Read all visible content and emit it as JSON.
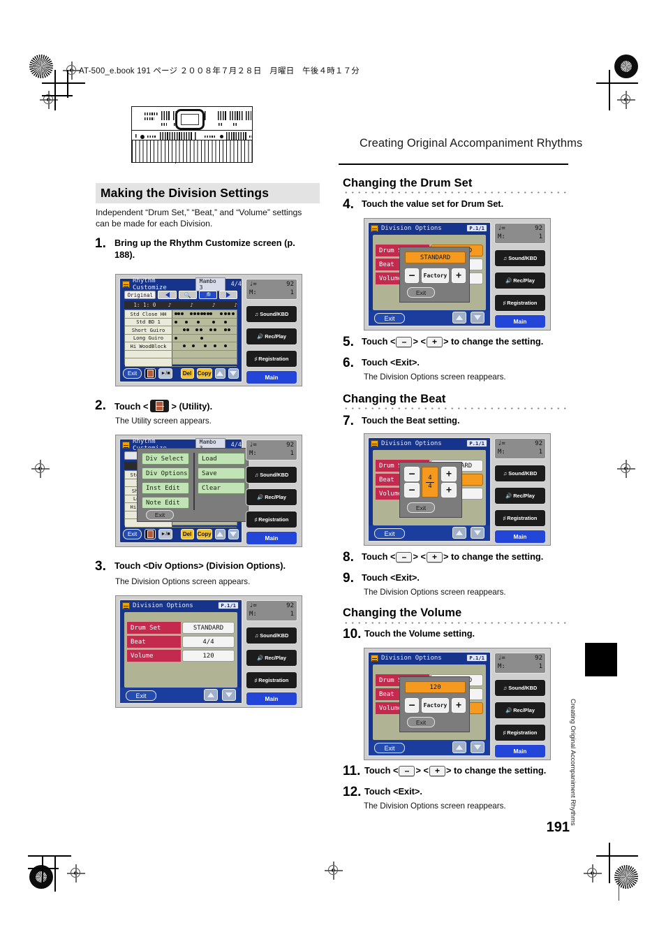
{
  "print_header": "AT-500_e.book 191 ページ ２００８年７月２８日　月曜日　午後４時１７分",
  "running_head": "Creating Original Accompaniment Rhythms",
  "side_tab_label": "Creating Original Accompaniment Rhythms",
  "page_number": "191",
  "left_column": {
    "section_title": "Making the Division Settings",
    "intro": "Independent “Drum Set,” “Beat,” and “Volume” settings can be made for each Division.",
    "steps": [
      {
        "num": "1.",
        "text": "Bring up the Rhythm Customize screen (p. 188).",
        "note": ""
      },
      {
        "num": "2.",
        "text_before": "Touch <",
        "text_after": "> (Utility).",
        "note": "The Utility screen appears."
      },
      {
        "num": "3.",
        "text": "Touch <Div Options> (Division Options).",
        "note": "The Division Options screen appears."
      }
    ]
  },
  "right_column": {
    "sections": [
      {
        "title": "Changing the Drum Set"
      },
      {
        "title": "Changing the Beat"
      },
      {
        "title": "Changing the Volume"
      }
    ],
    "steps": [
      {
        "num": "4.",
        "text": "Touch the value set for Drum Set.",
        "note": ""
      },
      {
        "num": "5.",
        "pre": "Touch <",
        "minus": "–",
        "mid": "> <",
        "plus": "+",
        "post": "> to change the setting.",
        "note": ""
      },
      {
        "num": "6.",
        "text": "Touch <Exit>.",
        "note": "The Division Options screen reappears."
      },
      {
        "num": "7.",
        "text": "Touch the Beat setting.",
        "note": ""
      },
      {
        "num": "8.",
        "pre": "Touch <",
        "minus": "–",
        "mid": "> <",
        "plus": "+",
        "post": "> to change the setting.",
        "note": ""
      },
      {
        "num": "9.",
        "text": "Touch <Exit>.",
        "note": "The Division Options screen reappears."
      },
      {
        "num": "10.",
        "text": "Touch the Volume setting.",
        "note": ""
      },
      {
        "num": "11.",
        "pre": "Touch <",
        "minus": "–",
        "mid": "> <",
        "plus": "+",
        "post": "> to change the setting.",
        "note": ""
      },
      {
        "num": "12.",
        "text": "Touch <Exit>.",
        "note": "The Division Options screen reappears."
      }
    ]
  },
  "lcd_common": {
    "tempo_note": "♩=",
    "tempo_value": "92",
    "measure_label": "M:",
    "measure_value": "1",
    "buttons": [
      {
        "label": "Sound/KBD",
        "icon": "note-icon"
      },
      {
        "label": "Rec/Play",
        "icon": "speaker-icon"
      },
      {
        "label": "Registration",
        "icon": "registration-icon"
      }
    ],
    "main_button": "Main",
    "exit_button": "Exit",
    "page_badge": "P.1/1"
  },
  "screens": {
    "rhythm_customize": {
      "title": "Rhythm Customize",
      "rhythm_name": "Mambo 3",
      "beat": "4/4",
      "original_button": "Original",
      "position": "1: 1:  0",
      "tracks": [
        {
          "name": "Std Close HH",
          "hits": [
            3,
            8,
            13,
            27,
            33,
            38,
            43,
            48,
            53,
            58,
            74,
            80,
            86,
            92
          ]
        },
        {
          "name": "Std BD 1",
          "hits": [
            3,
            20,
            38,
            62,
            80
          ]
        },
        {
          "name": "Short Guiro",
          "hits": [
            16,
            22,
            36,
            42,
            58,
            64,
            80,
            86
          ]
        },
        {
          "name": "Long Guiro",
          "hits": [
            3,
            43
          ]
        },
        {
          "name": "Hi WoodBlock",
          "hits": [
            16,
            30,
            49,
            64,
            80
          ]
        },
        {
          "name": "",
          "hits": []
        },
        {
          "name": "",
          "hits": []
        }
      ],
      "bottom_buttons": [
        "Exit",
        "utility-icon",
        "▶/■",
        "Del",
        "Copy",
        "up-arrow",
        "down-arrow"
      ]
    },
    "utility_overlay": {
      "left_items": [
        "Div Select",
        "Div Options",
        "Inst Edit",
        "Note Edit"
      ],
      "right_items": [
        "Load",
        "Save",
        "Clear"
      ],
      "exit_button": "Exit"
    },
    "division_options": {
      "title": "Division Options",
      "rows": [
        {
          "label": "Drum Set",
          "value": "STANDARD"
        },
        {
          "label": "Beat",
          "value": "4/4"
        },
        {
          "label": "Volume",
          "value": "120"
        }
      ]
    },
    "drum_set_popup": {
      "value": "STANDARD",
      "minus": "–",
      "factory": "Factory",
      "plus": "+",
      "exit": "Exit",
      "selected_row": 0
    },
    "beat_popup": {
      "numerator": "4",
      "denominator": "4",
      "minus": "–",
      "plus": "+",
      "exit": "Exit",
      "selected_row": 1
    },
    "volume_popup": {
      "value": "120",
      "minus": "–",
      "factory": "Factory",
      "plus": "+",
      "exit": "Exit",
      "selected_row": 2
    }
  },
  "colors": {
    "lcd_blue": "#16348c",
    "label_red": "#c42a4e",
    "highlight_orange": "#f59a1e",
    "panel_olive": "#b0b394",
    "accent_blue": "#2446d8"
  }
}
